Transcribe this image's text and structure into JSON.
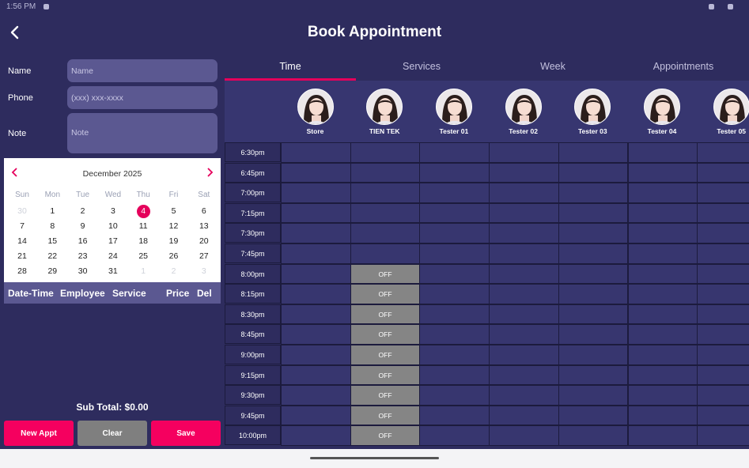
{
  "status_bar": {
    "time": "1:56 PM"
  },
  "header": {
    "title": "Book Appointment"
  },
  "form": {
    "name": {
      "label": "Name",
      "placeholder": "Name",
      "value": ""
    },
    "phone": {
      "label": "Phone",
      "placeholder": "(xxx) xxx-xxxx",
      "value": ""
    },
    "note": {
      "label": "Note",
      "placeholder": "Note",
      "value": ""
    }
  },
  "calendar": {
    "month_label": "December 2025",
    "prev": "‹",
    "next": "›",
    "weekdays": [
      "Sun",
      "Mon",
      "Tue",
      "Wed",
      "Thu",
      "Fri",
      "Sat"
    ],
    "weeks": [
      [
        "30",
        "1",
        "2",
        "3",
        "4",
        "5",
        "6"
      ],
      [
        "7",
        "8",
        "9",
        "10",
        "11",
        "12",
        "13"
      ],
      [
        "14",
        "15",
        "16",
        "17",
        "18",
        "19",
        "20"
      ],
      [
        "21",
        "22",
        "23",
        "24",
        "25",
        "26",
        "27"
      ],
      [
        "28",
        "29",
        "30",
        "31",
        "1",
        "2",
        "3"
      ]
    ],
    "selected_day": "4"
  },
  "cart": {
    "columns": [
      "Date-Time",
      "Employee",
      "Service",
      "Price",
      "Del"
    ],
    "subtotal": "Sub Total: $0.00"
  },
  "buttons": {
    "new_appt": "New Appt",
    "clear": "Clear",
    "save": "Save"
  },
  "tabs": [
    {
      "label": "Time",
      "active": true
    },
    {
      "label": "Services",
      "active": false
    },
    {
      "label": "Week",
      "active": false
    },
    {
      "label": "Appointments",
      "active": false
    }
  ],
  "staff": [
    {
      "name": "Store"
    },
    {
      "name": "TIEN TEK"
    },
    {
      "name": "Tester 01"
    },
    {
      "name": "Tester 02"
    },
    {
      "name": "Tester 03"
    },
    {
      "name": "Tester 04"
    },
    {
      "name": "Tester 05"
    }
  ],
  "schedule": {
    "off_label": "OFF",
    "times": [
      "6:30pm",
      "6:45pm",
      "7:00pm",
      "7:15pm",
      "7:30pm",
      "7:45pm",
      "8:00pm",
      "8:15pm",
      "8:30pm",
      "8:45pm",
      "9:00pm",
      "9:15pm",
      "9:30pm",
      "9:45pm",
      "10:00pm"
    ],
    "rows": [
      [
        false,
        false,
        false,
        false,
        false,
        false,
        false
      ],
      [
        false,
        false,
        false,
        false,
        false,
        false,
        false
      ],
      [
        false,
        false,
        false,
        false,
        false,
        false,
        false
      ],
      [
        false,
        false,
        false,
        false,
        false,
        false,
        false
      ],
      [
        false,
        false,
        false,
        false,
        false,
        false,
        false
      ],
      [
        false,
        false,
        false,
        false,
        false,
        false,
        false
      ],
      [
        false,
        true,
        false,
        false,
        false,
        false,
        false
      ],
      [
        false,
        true,
        false,
        false,
        false,
        false,
        false
      ],
      [
        false,
        true,
        false,
        false,
        false,
        false,
        false
      ],
      [
        false,
        true,
        false,
        false,
        false,
        false,
        false
      ],
      [
        false,
        true,
        false,
        false,
        false,
        false,
        false
      ],
      [
        false,
        true,
        false,
        false,
        false,
        false,
        false
      ],
      [
        false,
        true,
        false,
        false,
        false,
        false,
        false
      ],
      [
        false,
        true,
        false,
        false,
        false,
        false,
        false
      ],
      [
        false,
        true,
        false,
        false,
        false,
        false,
        false
      ]
    ]
  },
  "colors": {
    "background": "#2e2c5e",
    "accent": "#e5005b",
    "input": "#5b5891",
    "slot": "#37366f",
    "off_slot": "#858585",
    "clear_button": "#7f7f7f"
  }
}
